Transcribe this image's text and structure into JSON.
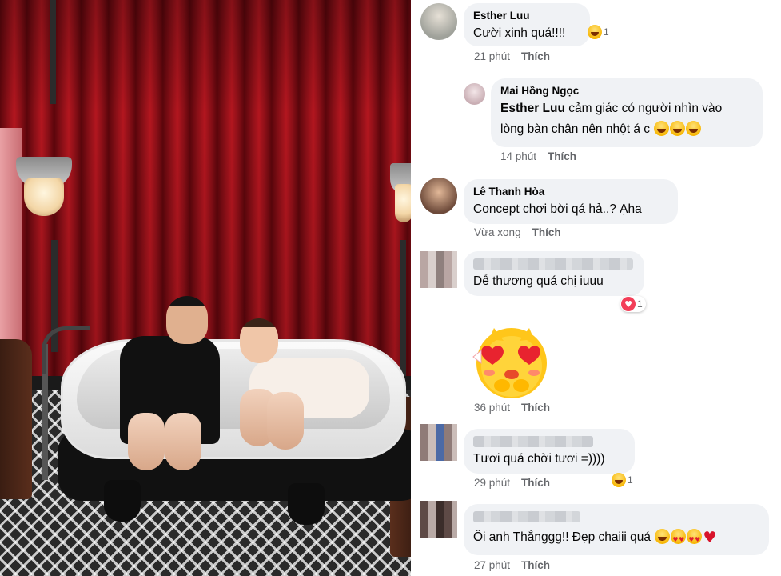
{
  "photo": {
    "icon": "photo-couple-in-bathtub"
  },
  "comments": [
    {
      "author": "Esther Luu",
      "text": "Cười xinh quá!!!!",
      "emojis": [
        "laugh"
      ],
      "reaction": {
        "icon": "haha",
        "count": "1"
      },
      "time": "21 phút",
      "like": "Thích"
    },
    {
      "author": "Mai Hồng Ngọc",
      "tag": "Esther Luu",
      "text_line1": " cảm giác có người nhìn vào",
      "text_line2": "lòng bàn chân nên nhột á c",
      "time": "14 phút",
      "like": "Thích"
    },
    {
      "author": "Lê Thanh Hòa",
      "text": "Concept chơi bời qá hả..? Ạha",
      "time": "Vừa xong",
      "like": "Thích"
    },
    {
      "text": "Dễ thương quá chị iuuu",
      "reaction": {
        "icon": "love",
        "count": "1"
      },
      "time": "36 phút",
      "like": "Thích",
      "sticker": "heart-eyes-chick-sticker"
    },
    {
      "text": "Tươi quá chời tươi =))))",
      "reaction": {
        "icon": "haha",
        "count": "1"
      },
      "time": "29 phút",
      "like": "Thích"
    },
    {
      "text": "Ôi anh Thắnggg!! Đẹp chaiii quá",
      "time": "27 phút",
      "like": "Thích"
    }
  ],
  "colors": {
    "bubble": "#f0f2f5",
    "meta_text": "#65676b",
    "text": "#050505",
    "love_reaction": "#f33e58",
    "haha_reaction": "#f7b500"
  }
}
